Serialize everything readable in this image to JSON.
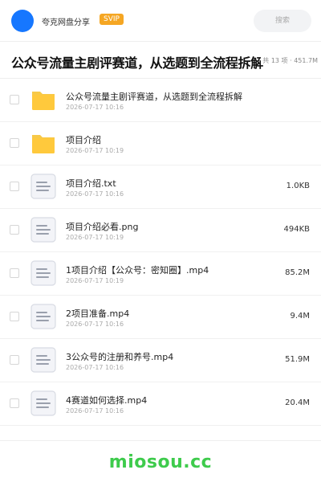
{
  "header": {
    "username": "夸克网盘分享",
    "vip_badge": "SVIP",
    "search_placeholder": "搜索",
    "colors": {
      "avatar": "#1677ff",
      "vip": "#f5a623"
    }
  },
  "folder": {
    "title": "公众号流量主剧评赛道，从选题到全流程拆解",
    "meta": "共 13 项 · 451.7M"
  },
  "files": [
    {
      "type": "folder",
      "icon": "folder-icon",
      "name": "公众号流量主剧评赛道，从选题到全流程拆解",
      "date": "2026-07-17 10:16",
      "size": ""
    },
    {
      "type": "folder",
      "icon": "folder-icon",
      "name": "项目介绍",
      "date": "2026-07-17 10:19",
      "size": ""
    },
    {
      "type": "file",
      "icon": "document-icon",
      "name": "项目介绍.txt",
      "date": "2026-07-17 10:16",
      "size": "1.0KB"
    },
    {
      "type": "file",
      "icon": "document-icon",
      "name": "项目介绍必看.png",
      "date": "2026-07-17 10:19",
      "size": "494KB"
    },
    {
      "type": "file",
      "icon": "document-icon",
      "name": "1项目介绍【公众号：密知圈】.mp4",
      "date": "2026-07-17 10:19",
      "size": "85.2M"
    },
    {
      "type": "file",
      "icon": "document-icon",
      "name": "2项目准备.mp4",
      "date": "2026-07-17 10:16",
      "size": "9.4M"
    },
    {
      "type": "file",
      "icon": "document-icon",
      "name": "3公众号的注册和养号.mp4",
      "date": "2026-07-17 10:16",
      "size": "51.9M"
    },
    {
      "type": "file",
      "icon": "document-icon",
      "name": "4赛道如何选择.mp4",
      "date": "2026-07-17 10:16",
      "size": "20.4M"
    }
  ],
  "footer": {
    "brand": "miosou.cc",
    "brand_color": "#3ecb4c"
  }
}
